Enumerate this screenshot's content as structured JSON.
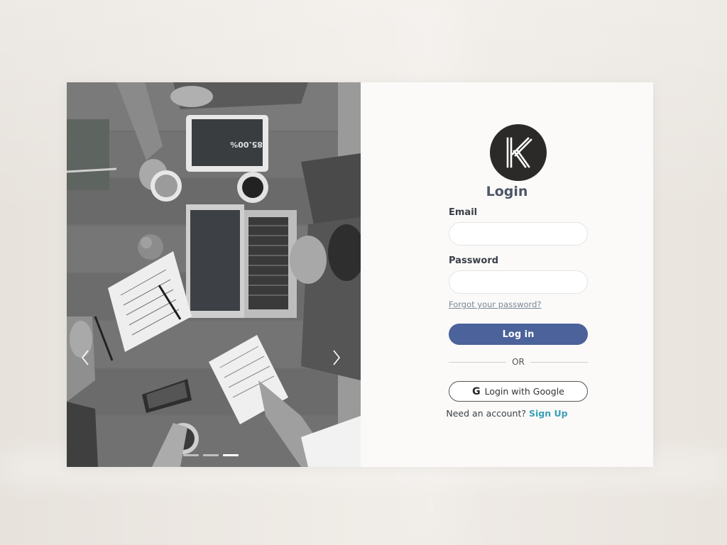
{
  "login": {
    "title": "Login",
    "email_label": "Email",
    "email_value": "",
    "email_placeholder": "",
    "password_label": "Password",
    "password_value": "",
    "password_placeholder": "",
    "forgot_password": "Forgot your password?",
    "login_button": "Log in",
    "divider_text": "OR",
    "google_button": "Login with Google",
    "google_icon": "G",
    "need_account": "Need an account?",
    "signup_link": "Sign Up"
  },
  "brand": {
    "logo_icon": "k-logo-icon",
    "logo_color": "#2b2a29"
  },
  "carousel": {
    "slides": 3,
    "active_slide": 3
  },
  "colors": {
    "primary_button": "#4b629a",
    "link": "#3aa0b8",
    "title": "#4d5665"
  }
}
